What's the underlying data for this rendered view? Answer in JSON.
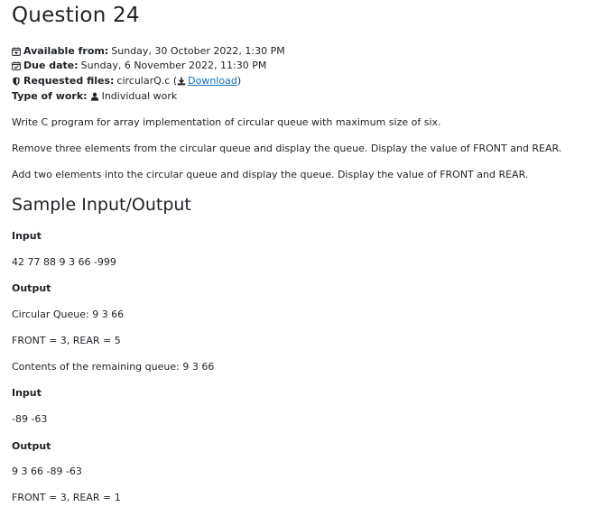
{
  "page": {
    "title": "Question 24"
  },
  "meta": {
    "available_label": "Available from:",
    "available_value": "Sunday, 30 October 2022, 1:30 PM",
    "due_label": "Due date:",
    "due_value": "Sunday, 6 November 2022, 11:30 PM",
    "files_label": "Requested files:",
    "files_value": "circularQ.c (",
    "download_label": "Download",
    "files_close": ")",
    "work_label": "Type of work:",
    "work_value": "Individual work"
  },
  "description": {
    "p1": "Write C program for array implementation of circular queue with maximum size of six.",
    "p2": "Remove three elements from the circular queue and display the queue. Display the value of FRONT and REAR.",
    "p3": "Add two elements into the circular queue and display the queue. Display the value of FRONT and REAR."
  },
  "sample": {
    "heading": "Sample Input/Output",
    "input1_label": "Input",
    "input1_value": "42 77 88 9 3 66 -999",
    "output1_label": "Output",
    "output1_line1": "Circular Queue: 9 3 66",
    "output1_line2": "FRONT = 3, REAR = 5",
    "output1_line3": "Contents of the remaining queue: 9 3 66",
    "input2_label": "Input",
    "input2_value": "-89 -63",
    "output2_label": "Output",
    "output2_line1": "9 3 66 -89 -63",
    "output2_line2": "FRONT = 3, REAR = 1"
  },
  "colors": {
    "link": "#0f6cbf",
    "text": "#1d2125"
  },
  "icons": {
    "available": "calendar-plus-icon",
    "due": "calendar-check-icon",
    "files": "shield-icon",
    "download": "download-icon",
    "work": "user-icon"
  }
}
